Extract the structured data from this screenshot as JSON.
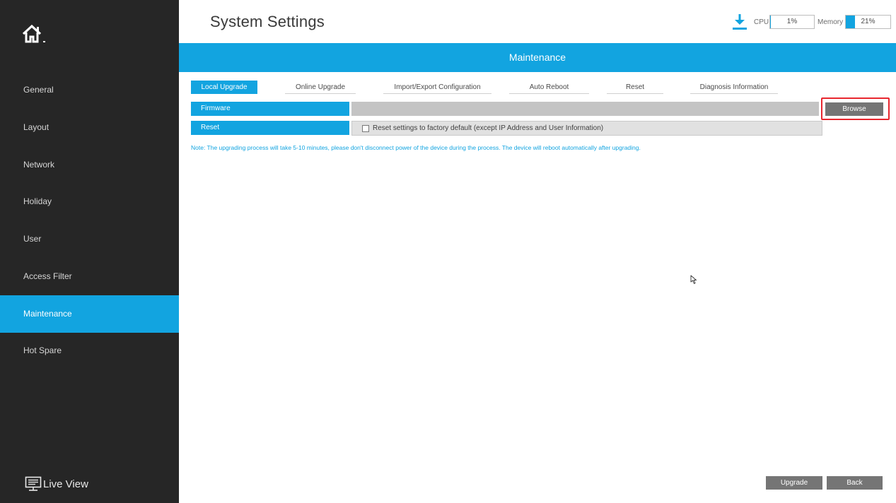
{
  "sidebar": {
    "home_icon": "home-icon",
    "items": [
      {
        "label": "General"
      },
      {
        "label": "Layout"
      },
      {
        "label": "Network"
      },
      {
        "label": "Holiday"
      },
      {
        "label": "User"
      },
      {
        "label": "Access Filter"
      },
      {
        "label": "Maintenance",
        "active": true
      },
      {
        "label": "Hot Spare"
      }
    ],
    "live_view_label": "Live View",
    "live_view_icon": "monitor-icon"
  },
  "header": {
    "title": "System Settings",
    "download_icon": "download-icon",
    "cpu_label": "CPU",
    "cpu_value": "1%",
    "cpu_usage": 0.01,
    "memory_label": "Memory",
    "memory_value": "21%",
    "memory_usage": 0.21
  },
  "section": {
    "title": "Maintenance"
  },
  "tabs": [
    {
      "label": "Local Upgrade",
      "active": true
    },
    {
      "label": "Online Upgrade"
    },
    {
      "label": "Import/Export Configuration"
    },
    {
      "label": "Auto Reboot"
    },
    {
      "label": "Reset"
    },
    {
      "label": "Diagnosis Information"
    }
  ],
  "form": {
    "firmware_label": "Firmware",
    "firmware_value": "",
    "browse_label": "Browse",
    "reset_label": "Reset",
    "reset_checkbox_label": "Reset settings to factory default (except IP Address and User Information)",
    "reset_checked": false
  },
  "note": "Note: The upgrading process will take 5-10 minutes, please don't disconnect power of the device during the process. The device will reboot automatically after upgrading.",
  "footer": {
    "upgrade_label": "Upgrade",
    "back_label": "Back"
  },
  "colors": {
    "accent": "#12a4e0",
    "sidebar_bg": "#262626",
    "highlight": "#e8262e",
    "button_gray": "#757575"
  }
}
